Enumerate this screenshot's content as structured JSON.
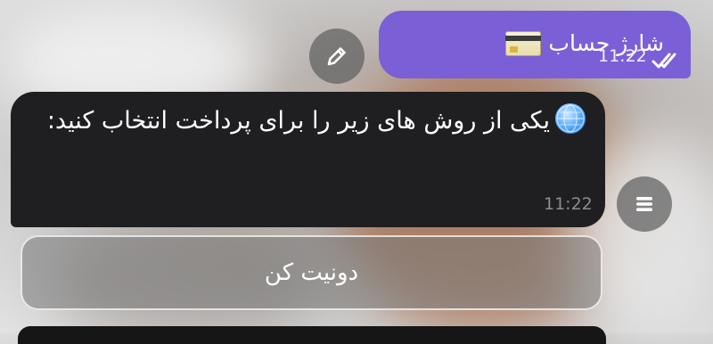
{
  "outgoing_message": {
    "text": "شارژ حساب",
    "icon": "credit-card-icon",
    "time": "11:22",
    "status_icon": "double-check-icon",
    "bubble_color": "#7a5fd6"
  },
  "incoming_message": {
    "text": "یکی از روش های زیر را برای پرداخت انتخاب کنید:",
    "icon": "globe-icon",
    "time": "11:22",
    "bubble_color": "#1f1f21"
  },
  "actions": {
    "edit_icon": "pencil-icon",
    "menu_icon": "list-menu-icon"
  },
  "keyboard": {
    "buttons": [
      {
        "label": "دونیت کن"
      }
    ]
  }
}
